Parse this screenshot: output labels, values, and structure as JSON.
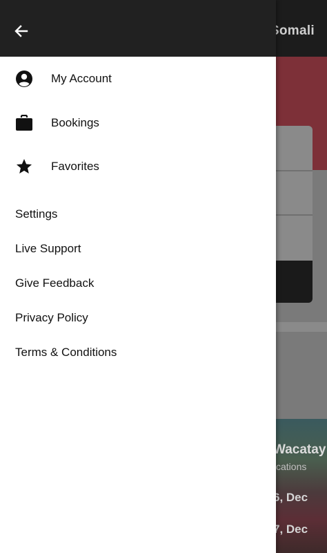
{
  "background": {
    "title": "Somali",
    "card_title": "Wacatay",
    "card_subtitle": "cations",
    "date_1": "6, Dec",
    "date_2": "7, Dec"
  },
  "drawer": {
    "back_icon": "arrow-left-icon",
    "primary_items": [
      {
        "label": "My Account",
        "icon": "account-circle-icon"
      },
      {
        "label": "Bookings",
        "icon": "briefcase-icon"
      },
      {
        "label": "Favorites",
        "icon": "star-icon"
      }
    ],
    "secondary_items": [
      {
        "label": "Settings"
      },
      {
        "label": "Live Support"
      },
      {
        "label": "Give Feedback"
      },
      {
        "label": "Privacy Policy"
      },
      {
        "label": "Terms & Conditions"
      }
    ]
  },
  "colors": {
    "header_bg": "#212121",
    "drawer_bg": "#ffffff",
    "text": "#111111",
    "scrim": "#7a7a7a"
  }
}
